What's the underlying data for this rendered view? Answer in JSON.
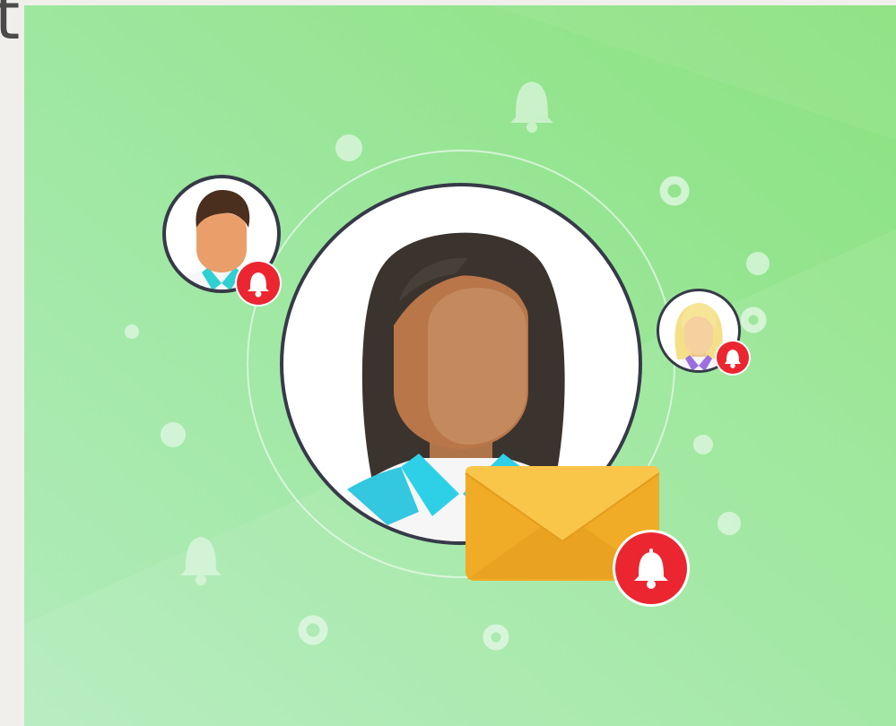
{
  "cropped_heading_fragment": "t",
  "illustration": {
    "background_colors": [
      "#9ee8a0",
      "#8fe486",
      "#b6eec2"
    ],
    "badge_color": "#ec2630",
    "envelope_color": "#f5b93a",
    "icons": [
      "bell-icon",
      "envelope-icon",
      "avatar-woman",
      "avatar-man",
      "avatar-blonde-woman"
    ]
  }
}
